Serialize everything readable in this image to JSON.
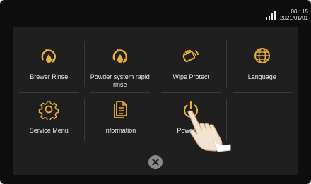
{
  "status": {
    "time": "00 : 15",
    "date": "2021/01/01",
    "signal_icon": "signal-bars-icon"
  },
  "menu": {
    "items": [
      {
        "label": "Brewer Rinse",
        "icon": "brewer-rinse-icon"
      },
      {
        "label": "Powder system rapid rinse",
        "icon": "powder-rinse-icon"
      },
      {
        "label": "Wipe Protect",
        "icon": "wipe-protect-icon"
      },
      {
        "label": "Language",
        "icon": "globe-icon"
      },
      {
        "label": "Service Menu",
        "icon": "gear-icon"
      },
      {
        "label": "Information",
        "icon": "document-icon"
      },
      {
        "label": "Power Off",
        "icon": "power-icon"
      }
    ]
  },
  "close": {
    "icon": "close-icon"
  },
  "colors": {
    "accent": "#e7ad3e",
    "background": "#0d0d0d",
    "panel": "#1f1f1f",
    "text": "#ececec"
  }
}
